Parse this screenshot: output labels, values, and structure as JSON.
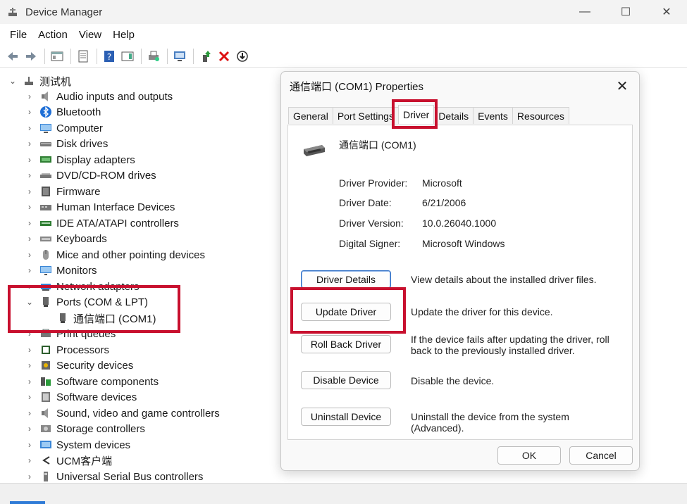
{
  "window": {
    "title": "Device Manager",
    "controls": {
      "minimize": "—",
      "maximize": "☐",
      "close": "✕"
    }
  },
  "menu": [
    "File",
    "Action",
    "View",
    "Help"
  ],
  "tree": {
    "root": "测试机",
    "items": [
      {
        "label": "Audio inputs and outputs",
        "icon": "speaker-icon"
      },
      {
        "label": "Bluetooth",
        "icon": "bluetooth-icon"
      },
      {
        "label": "Computer",
        "icon": "computer-icon"
      },
      {
        "label": "Disk drives",
        "icon": "disk-drive-icon"
      },
      {
        "label": "Display adapters",
        "icon": "display-adapter-icon"
      },
      {
        "label": "DVD/CD-ROM drives",
        "icon": "dvd-drive-icon"
      },
      {
        "label": "Firmware",
        "icon": "firmware-icon"
      },
      {
        "label": "Human Interface Devices",
        "icon": "hid-icon"
      },
      {
        "label": "IDE ATA/ATAPI controllers",
        "icon": "ide-controller-icon"
      },
      {
        "label": "Keyboards",
        "icon": "keyboard-icon"
      },
      {
        "label": "Mice and other pointing devices",
        "icon": "mouse-icon"
      },
      {
        "label": "Monitors",
        "icon": "monitor-icon"
      },
      {
        "label": "Network adapters",
        "icon": "network-adapter-icon"
      },
      {
        "label": "Ports (COM & LPT)",
        "icon": "port-icon"
      },
      {
        "label": "通信端口 (COM1)",
        "icon": "port-icon"
      },
      {
        "label": "Print queues",
        "icon": "printer-icon"
      },
      {
        "label": "Processors",
        "icon": "processor-icon"
      },
      {
        "label": "Security devices",
        "icon": "security-device-icon"
      },
      {
        "label": "Software components",
        "icon": "software-component-icon"
      },
      {
        "label": "Software devices",
        "icon": "software-device-icon"
      },
      {
        "label": "Sound, video and game controllers",
        "icon": "sound-icon"
      },
      {
        "label": "Storage controllers",
        "icon": "storage-icon"
      },
      {
        "label": "System devices",
        "icon": "system-device-icon"
      },
      {
        "label": "UCM客户端",
        "icon": "ucm-icon"
      },
      {
        "label": "Universal Serial Bus controllers",
        "icon": "usb-icon"
      }
    ]
  },
  "dialog": {
    "title": "通信端口 (COM1) Properties",
    "tabs": [
      "General",
      "Port Settings",
      "Driver",
      "Details",
      "Events",
      "Resources"
    ],
    "active_tab": "Driver",
    "device_name": "通信端口 (COM1)",
    "info": [
      {
        "label": "Driver Provider:",
        "value": "Microsoft"
      },
      {
        "label": "Driver Date:",
        "value": "6/21/2006"
      },
      {
        "label": "Driver Version:",
        "value": "10.0.26040.1000"
      },
      {
        "label": "Digital Signer:",
        "value": "Microsoft Windows"
      }
    ],
    "actions": [
      {
        "label": "Driver Details",
        "description": "View details about the installed driver files."
      },
      {
        "label": "Update Driver",
        "description": "Update the driver for this device."
      },
      {
        "label": "Roll Back Driver",
        "description": "If the device fails after updating the driver, roll back to the previously installed driver."
      },
      {
        "label": "Disable Device",
        "description": "Disable the device."
      },
      {
        "label": "Uninstall Device",
        "description": "Uninstall the device from the system (Advanced)."
      }
    ],
    "ok_label": "OK",
    "cancel_label": "Cancel"
  },
  "colors": {
    "highlight": "#c8102e",
    "accent": "#2f6fc6"
  }
}
